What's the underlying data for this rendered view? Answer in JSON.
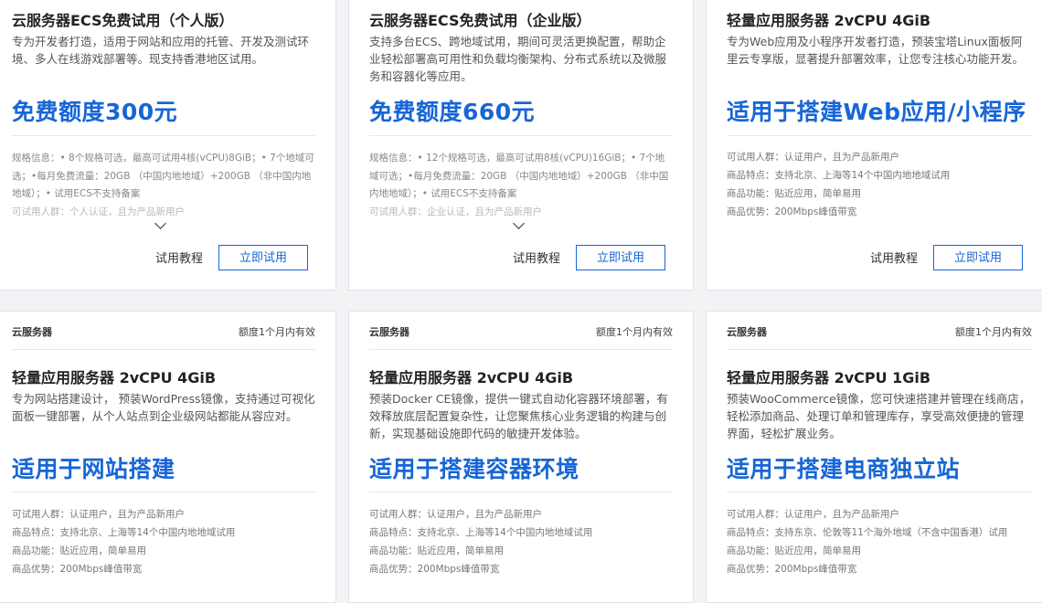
{
  "top_cards": [
    {
      "title": "云服务器ECS免费试用（个人版）",
      "desc": "专为开发者打造，适用于网站和应用的托管、开发及测试环境、多人在线游戏部署等。现支持香港地区试用。",
      "highlight": "免费额度300元",
      "spec": "规格信息：• 8个规格可选，最高可试用4核(vCPU)8GiB；• 7个地域可选；•每月免费流量：20GB （中国内地地域）+200GB （非中国内地地域）；• 试用ECS不支持备案",
      "spec_faded": "可试用人群：个人认证，且为产品新用户",
      "tutorial": "试用教程",
      "button": "立即试用"
    },
    {
      "title": "云服务器ECS免费试用（企业版）",
      "desc": "支持多台ECS、跨地域试用，期间可灵活更换配置，帮助企业轻松部署高可用性和负载均衡架构、分布式系统以及微服务和容器化等应用。",
      "highlight": "免费额度660元",
      "spec": "规格信息：• 12个规格可选，最高可试用8核(vCPU)16GiB；• 7个地域可选；•每月免费流量：20GB （中国内地地域）+200GB （非中国内地地域）；• 试用ECS不支持备案",
      "spec_faded": "可试用人群：企业认证，且为产品新用户",
      "tutorial": "试用教程",
      "button": "立即试用"
    },
    {
      "title": "轻量应用服务器 2vCPU 4GiB",
      "desc": "专为Web应用及小程序开发者打造，预装宝塔Linux面板阿里云专享版，显著提升部署效率，让您专注核心功能开发。",
      "highlight": "适用于搭建Web应用/小程序",
      "rows": [
        {
          "k": "可试用人群",
          "v": "认证用户，且为产品新用户"
        },
        {
          "k": "商品特点",
          "v": "支持北京、上海等14个中国内地地域试用"
        },
        {
          "k": "商品功能",
          "v": "贴近应用，简单易用"
        },
        {
          "k": "商品优势",
          "v": "200Mbps峰值带宽"
        }
      ],
      "tutorial": "试用教程",
      "button": "立即试用"
    }
  ],
  "bottom_cards": [
    {
      "category": "云服务器",
      "validity": "额度1个月内有效",
      "title": "轻量应用服务器 2vCPU 4GiB",
      "desc": "专为网站搭建设计， 预装WordPress镜像，支持通过可视化面板一键部署，从个人站点到企业级网站都能从容应对。",
      "highlight": "适用于网站搭建",
      "rows": [
        {
          "k": "可试用人群",
          "v": "认证用户，且为产品新用户"
        },
        {
          "k": "商品特点",
          "v": "支持北京、上海等14个中国内地地域试用"
        },
        {
          "k": "商品功能",
          "v": "贴近应用，简单易用"
        },
        {
          "k": "商品优势",
          "v": "200Mbps峰值带宽"
        }
      ]
    },
    {
      "category": "云服务器",
      "validity": "额度1个月内有效",
      "title": "轻量应用服务器 2vCPU 4GiB",
      "desc": "预装Docker CE镜像，提供一键式自动化容器环境部署，有效释放底层配置复杂性，让您聚焦核心业务逻辑的构建与创新，实现基础设施即代码的敏捷开发体验。",
      "highlight": "适用于搭建容器环境",
      "rows": [
        {
          "k": "可试用人群",
          "v": "认证用户，且为产品新用户"
        },
        {
          "k": "商品特点",
          "v": "支持北京、上海等14个中国内地地域试用"
        },
        {
          "k": "商品功能",
          "v": "贴近应用，简单易用"
        },
        {
          "k": "商品优势",
          "v": "200Mbps峰值带宽"
        }
      ]
    },
    {
      "category": "云服务器",
      "validity": "额度1个月内有效",
      "title": "轻量应用服务器 2vCPU 1GiB",
      "desc": "预装WooCommerce镜像，您可快速搭建并管理在线商店，轻松添加商品、处理订单和管理库存，享受高效便捷的管理界面，轻松扩展业务。",
      "highlight": "适用于搭建电商独立站",
      "rows": [
        {
          "k": "可试用人群",
          "v": "认证用户，且为产品新用户"
        },
        {
          "k": "商品特点",
          "v": "支持东京、伦敦等11个海外地域（不含中国香港）试用"
        },
        {
          "k": "商品功能",
          "v": "贴近应用，简单易用"
        },
        {
          "k": "商品优势",
          "v": "200Mbps峰值带宽"
        }
      ]
    }
  ],
  "kv_separator": "："
}
